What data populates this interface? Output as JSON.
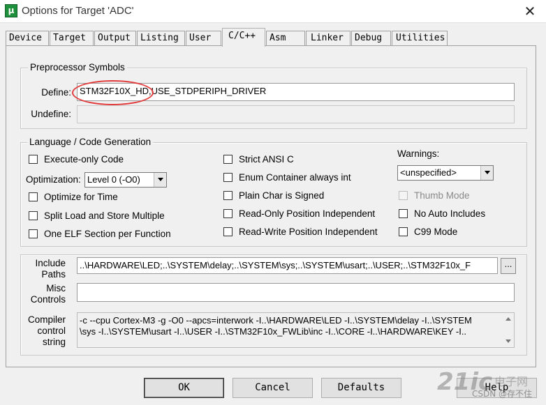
{
  "window": {
    "title": "Options for Target 'ADC'",
    "app_icon_text": "μ",
    "close_glyph": "✕"
  },
  "tabs": [
    {
      "label": "Device",
      "active": false
    },
    {
      "label": "Target",
      "active": false
    },
    {
      "label": "Output",
      "active": false
    },
    {
      "label": "Listing",
      "active": false
    },
    {
      "label": "User",
      "active": false
    },
    {
      "label": "C/C++",
      "active": true
    },
    {
      "label": "Asm",
      "active": false
    },
    {
      "label": "Linker",
      "active": false
    },
    {
      "label": "Debug",
      "active": false
    },
    {
      "label": "Utilities",
      "active": false
    }
  ],
  "preprocessor": {
    "group_label": "Preprocessor Symbols",
    "define_label": "Define:",
    "define_value": "STM32F10X_HD,USE_STDPERIPH_DRIVER",
    "undefine_label": "Undefine:",
    "undefine_value": ""
  },
  "language": {
    "group_label": "Language / Code Generation",
    "execute_only": "Execute-only Code",
    "optimization_label": "Optimization:",
    "optimization_value": "Level 0 (-O0)",
    "optimize_time": "Optimize for Time",
    "split_load": "Split Load and Store Multiple",
    "one_elf": "One ELF Section per Function",
    "strict_ansi": "Strict ANSI C",
    "enum_container": "Enum Container always int",
    "plain_char": "Plain Char is Signed",
    "ro_pi": "Read-Only Position Independent",
    "rw_pi": "Read-Write Position Independent",
    "warnings_label": "Warnings:",
    "warnings_value": "<unspecified>",
    "thumb_mode": "Thumb Mode",
    "no_auto_includes": "No Auto Includes",
    "c99_mode": "C99 Mode"
  },
  "paths": {
    "include_label_1": "Include",
    "include_label_2": "Paths",
    "include_value": "..\\HARDWARE\\LED;..\\SYSTEM\\delay;..\\SYSTEM\\sys;..\\SYSTEM\\usart;..\\USER;..\\STM32F10x_F",
    "browse_label": "...",
    "misc_label_1": "Misc",
    "misc_label_2": "Controls",
    "misc_value": "",
    "compiler_label_1": "Compiler",
    "compiler_label_2": "control",
    "compiler_label_3": "string",
    "compiler_line_1": "-c --cpu Cortex-M3 -g -O0 --apcs=interwork -I..\\HARDWARE\\LED -I..\\SYSTEM\\delay -I..\\SYSTEM",
    "compiler_line_2": "\\sys -I..\\SYSTEM\\usart -I..\\USER -I..\\STM32F10x_FWLib\\inc -I..\\CORE -I..\\HARDWARE\\KEY -I.."
  },
  "buttons": {
    "ok": "OK",
    "cancel": "Cancel",
    "defaults": "Defaults",
    "help": "Help"
  },
  "watermark": {
    "logo": "21ic",
    "brand": "电子网",
    "csdn": "CSDN @存不住"
  }
}
